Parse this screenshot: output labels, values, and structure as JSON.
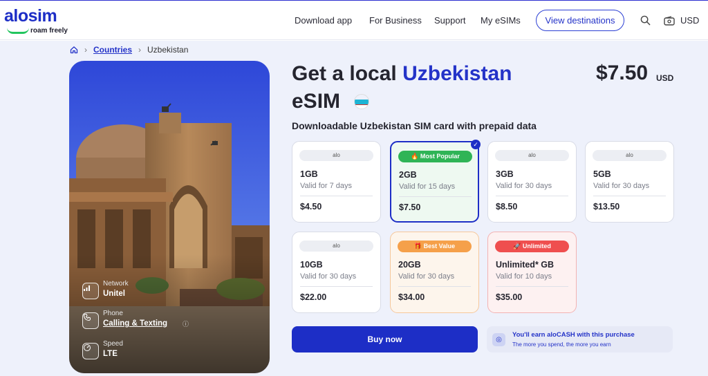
{
  "brand": {
    "name": "alosim",
    "tagline": "roam freely"
  },
  "nav": {
    "links": [
      "Download app",
      "For Business",
      "Support",
      "My eSIMs"
    ],
    "cta": "View destinations",
    "currency": "USD"
  },
  "breadcrumb": {
    "link": "Countries",
    "current": "Uzbekistan"
  },
  "hero_info": [
    {
      "label": "Network",
      "value": "Unitel",
      "icon": "signal-icon"
    },
    {
      "label": "Phone",
      "value": "Calling & Texting",
      "icon": "phone-icon"
    },
    {
      "label": "Speed",
      "value": "LTE",
      "icon": "speedometer-icon"
    }
  ],
  "product": {
    "title_prefix": "Get a local",
    "title_country": "Uzbekistan",
    "title_suffix": "eSIM",
    "price": "$7.50",
    "price_currency": "USD",
    "subtitle": "Downloadable Uzbekistan SIM card with prepaid data"
  },
  "plans": [
    {
      "tag": "alo",
      "badge": "",
      "data": "1GB",
      "validity": "Valid for 7 days",
      "price": "$4.50",
      "selected": false
    },
    {
      "tag": "",
      "badge": "🔥 Most Popular",
      "data": "2GB",
      "validity": "Valid for 15 days",
      "price": "$7.50",
      "selected": true
    },
    {
      "tag": "alo",
      "badge": "",
      "data": "3GB",
      "validity": "Valid for 30 days",
      "price": "$8.50",
      "selected": false
    },
    {
      "tag": "alo",
      "badge": "",
      "data": "5GB",
      "validity": "Valid for 30 days",
      "price": "$13.50",
      "selected": false
    },
    {
      "tag": "alo",
      "badge": "",
      "data": "10GB",
      "validity": "Valid for 30 days",
      "price": "$22.00",
      "selected": false
    },
    {
      "tag": "",
      "badge": "🎁 Best Value",
      "data": "20GB",
      "validity": "Valid for 30 days",
      "price": "$34.00",
      "selected": false
    },
    {
      "tag": "",
      "badge": "🚀 Unlimited",
      "data": "Unlimited* GB",
      "validity": "Valid for 10 days",
      "price": "$35.00",
      "selected": false
    }
  ],
  "actions": {
    "buy": "Buy now",
    "earn_title": "You'll earn aloCASH with this purchase",
    "earn_subtitle": "The more you spend, the more you earn"
  },
  "colors": {
    "accent": "#1d2ec6",
    "popular_badge": "#2fb456",
    "value_badge": "#f5a04a",
    "unlimited_badge": "#ef4f4f"
  }
}
